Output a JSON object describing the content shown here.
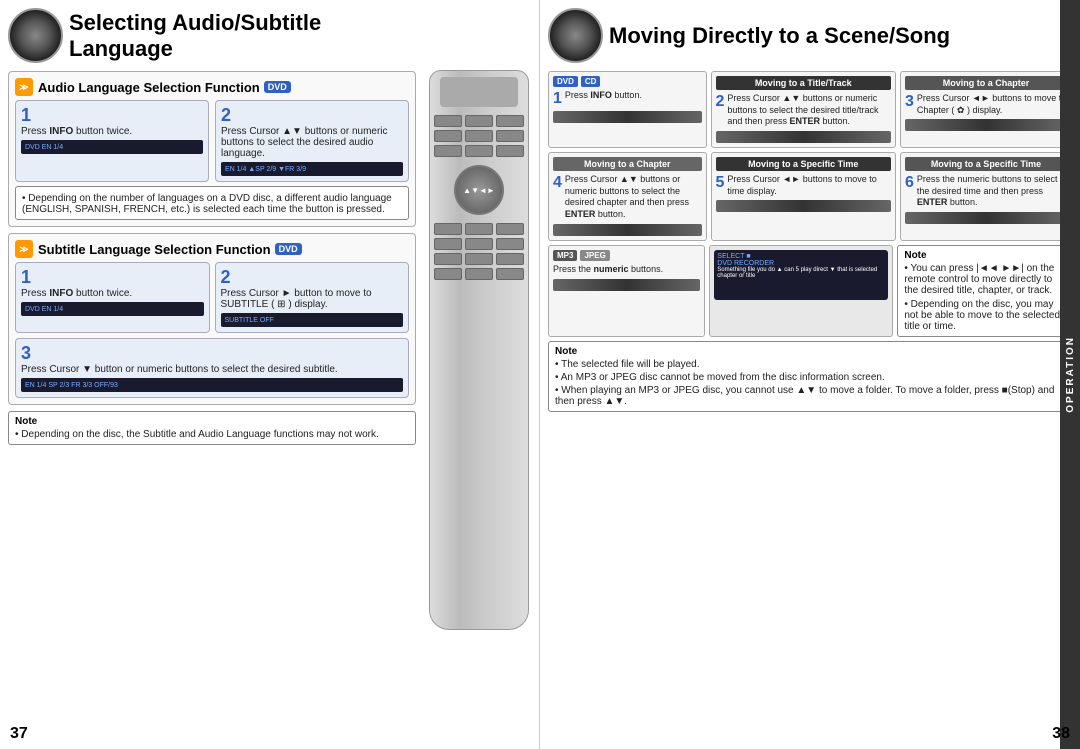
{
  "left": {
    "title": "Selecting Audio/Subtitle Language",
    "audio_section": {
      "heading": "Audio Language Selection Function",
      "badge": "DVD",
      "step1": {
        "num": "1",
        "line1": "Press ",
        "bold1": "INFO",
        "line2": " button",
        "line3": "twice."
      },
      "step2": {
        "num": "2",
        "line1": "Press Cursor ▲▼",
        "line2": "buttons or numeric",
        "line3": "buttons to select the",
        "line4": "desired audio language."
      },
      "note": "• Depending on the number of languages on a DVD disc, a different audio language (ENGLISH, SPANISH, FRENCH, etc.) is selected each time the button is pressed."
    },
    "subtitle_section": {
      "heading": "Subtitle Language Selection Function",
      "badge": "DVD",
      "step1": {
        "num": "1",
        "line1": "Press ",
        "bold1": "INFO",
        "line2": " button",
        "line3": "twice."
      },
      "step2": {
        "num": "2",
        "line1": "Press Cursor ►",
        "line2": "button to move to",
        "line3": "SUBTITLE (",
        "icon": "⊞",
        "line4": ")",
        "line5": "display."
      },
      "step3": {
        "num": "3",
        "line1": "Press Cursor ▼",
        "line2": "button or numeric",
        "line3": "buttons to select the",
        "line4": "desired subtitle."
      }
    },
    "note2": "• Depending on the disc, the Subtitle and Audio Language functions may not work.",
    "page_number": "37"
  },
  "right": {
    "title": "Moving Directly to a Scene/Song",
    "badge_dvd": "DVD",
    "badge_cd": "CD",
    "badge_mp3": "MP3",
    "badge_jpeg": "JPEG",
    "step1_info": {
      "num": "1",
      "text1": "Press ",
      "bold1": "INFO",
      "text2": " button."
    },
    "col_title_track": "Moving to a Title/Track",
    "col_title_chapter1": "Moving to a Chapter",
    "col_title_chapter2": "Moving to a Chapter",
    "col_title_specific1": "Moving to a Specific Time",
    "col_title_specific2": "Moving to a Specific Time",
    "step2": {
      "num": "2",
      "text": "Press Cursor ▲▼ buttons or numeric buttons to select the desired title/track and then press ENTER button."
    },
    "step3": {
      "num": "3",
      "text": "Press Cursor ◄► buttons to move to Chapter ( ✿ ) display."
    },
    "step4": {
      "num": "4",
      "text": "Press Cursor ▲▼ buttons or numeric buttons to select the desired chapter and then press ENTER button."
    },
    "step5": {
      "num": "5",
      "text": "Press Cursor ◄► buttons to move to time display."
    },
    "step6": {
      "num": "6",
      "text": "Press the numeric buttons to select the desired time and then press ENTER button."
    },
    "mp3_step": {
      "text1": "Press the ",
      "bold1": "numeric",
      "text2": " buttons."
    },
    "notes": {
      "title": "Note",
      "items": [
        "• The selected file will be played.",
        "• An MP3 or JPEG disc cannot be moved from the disc information screen.",
        "• When playing an MP3 or JPEG disc, you cannot use ▲▼ to move a folder. To move a folder, press ■(Stop) and then press ▲▼."
      ]
    },
    "note_right": {
      "title": "Note",
      "items": [
        "• You can press |◄◄ ►►| on the remote control to move directly to the desired title, chapter, or track.",
        "• Depending on the disc, you may not be able to move to the selected title or time."
      ]
    },
    "operation_label": "OPERATION",
    "page_number": "38"
  }
}
